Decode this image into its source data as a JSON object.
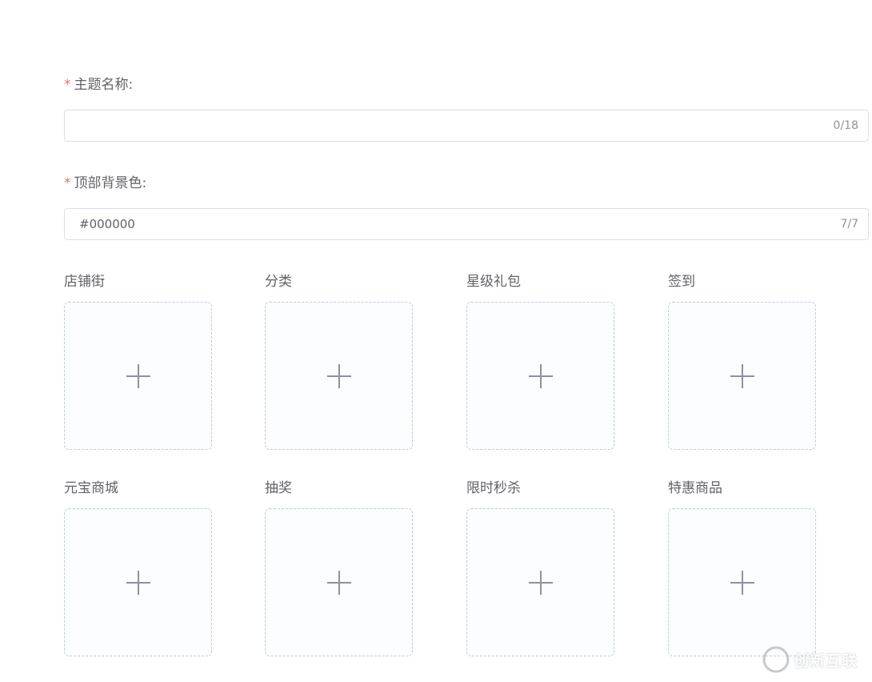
{
  "form": {
    "theme_name": {
      "required_mark": "*",
      "label": "主题名称:",
      "value": "",
      "counter": "0/18"
    },
    "top_bg_color": {
      "required_mark": "*",
      "label": "顶部背景色:",
      "value": "#000000",
      "counter": "7/7"
    }
  },
  "uploads": [
    {
      "label": "店铺街",
      "icon": "plus-icon"
    },
    {
      "label": "分类",
      "icon": "plus-icon"
    },
    {
      "label": "星级礼包",
      "icon": "plus-icon"
    },
    {
      "label": "签到",
      "icon": "plus-icon"
    },
    {
      "label": "元宝商城",
      "icon": "plus-icon"
    },
    {
      "label": "抽奖",
      "icon": "plus-icon"
    },
    {
      "label": "限时秒杀",
      "icon": "plus-icon"
    },
    {
      "label": "特惠商品",
      "icon": "plus-icon"
    }
  ],
  "watermark": {
    "text": "创新互联"
  },
  "colors": {
    "required": "#f56c6c",
    "label": "#606266",
    "border": "#dcdfe6",
    "upload_border": "#c0ccda",
    "upload_bg": "#fbfdff",
    "plus": "#8c939d"
  }
}
